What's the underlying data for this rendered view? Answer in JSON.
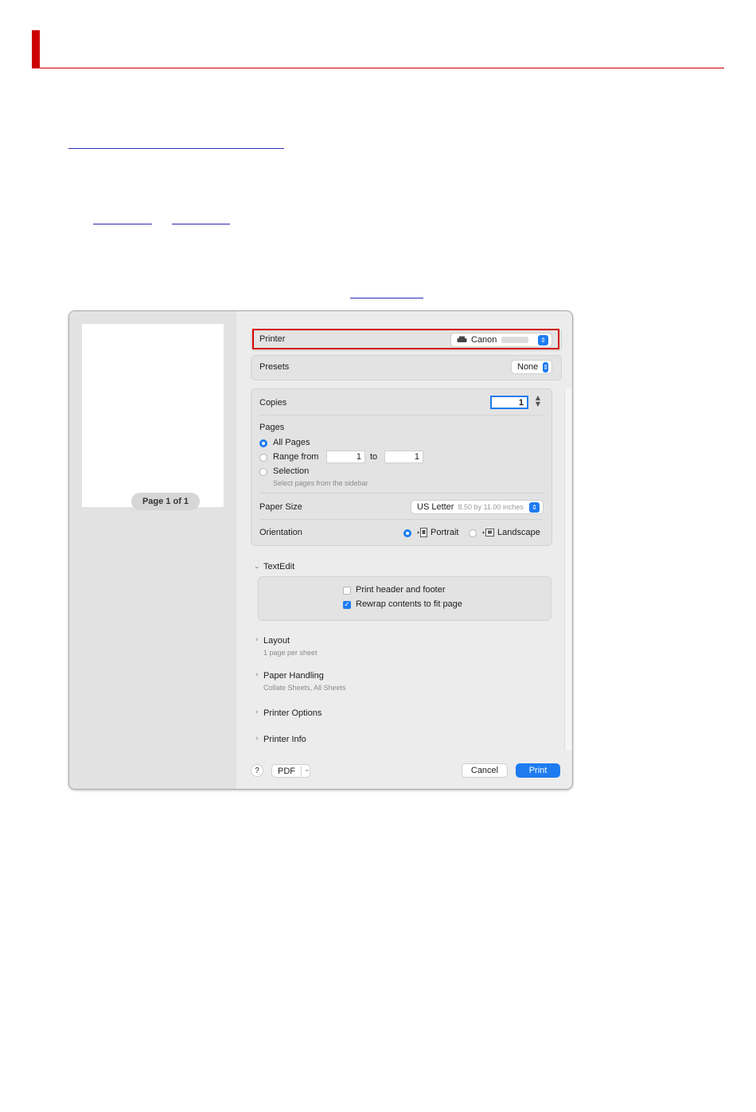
{
  "print_dialog": {
    "preview": {
      "page_indicator": "Page 1 of 1"
    },
    "printer": {
      "label": "Printer",
      "value": "Canon"
    },
    "presets": {
      "label": "Presets",
      "value": "None"
    },
    "copies": {
      "label": "Copies",
      "value": "1"
    },
    "pages": {
      "label": "Pages",
      "all_pages": "All Pages",
      "range_from": "Range from",
      "range_start": "1",
      "range_to": "to",
      "range_end": "1",
      "selection": "Selection",
      "selection_hint": "Select pages from the sidebar",
      "selected": "All Pages"
    },
    "paper_size": {
      "label": "Paper Size",
      "value": "US Letter",
      "detail": "8.50 by 11.00 inches"
    },
    "orientation": {
      "label": "Orientation",
      "portrait": "Portrait",
      "landscape": "Landscape",
      "selected": "Portrait"
    },
    "textedit": {
      "title": "TextEdit",
      "print_header_footer": "Print header and footer",
      "print_header_footer_checked": false,
      "rewrap": "Rewrap contents to fit page",
      "rewrap_checked": true
    },
    "layout": {
      "title": "Layout",
      "summary": "1 page per sheet"
    },
    "paper_handling": {
      "title": "Paper Handling",
      "summary": "Collate Sheets, All Sheets"
    },
    "printer_options": {
      "title": "Printer Options"
    },
    "printer_info": {
      "title": "Printer Info"
    },
    "footer": {
      "help": "?",
      "pdf": "PDF",
      "cancel": "Cancel",
      "print": "Print"
    }
  },
  "colors": {
    "accent": "#1e7cf0",
    "highlight": "#d20000",
    "header": "#cc0000"
  },
  "icons": [
    "printer-icon",
    "stepper-icon",
    "chevron-right-icon",
    "chevron-down-icon",
    "checkmark-icon",
    "portrait-icon",
    "landscape-icon"
  ]
}
